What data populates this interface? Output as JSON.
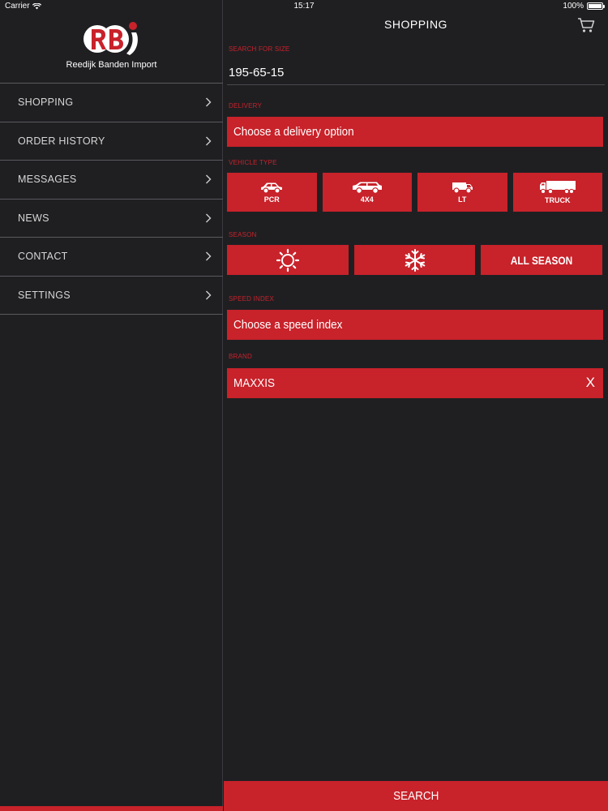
{
  "status_bar": {
    "carrier": "Carrier",
    "time": "15:17",
    "battery": "100%",
    "battery_level": 1.0
  },
  "sidebar": {
    "logo_text": "Reedijk Banden Import",
    "items": [
      {
        "label": "SHOPPING",
        "icon": "chevron-right-icon"
      },
      {
        "label": "ORDER HISTORY",
        "icon": "chevron-right-icon"
      },
      {
        "label": "MESSAGES",
        "icon": "chevron-right-icon"
      },
      {
        "label": "NEWS",
        "icon": "chevron-right-icon"
      },
      {
        "label": "CONTACT",
        "icon": "chevron-right-icon"
      },
      {
        "label": "SETTINGS",
        "icon": "chevron-right-icon"
      }
    ]
  },
  "main": {
    "title": "SHOPPING",
    "cart_icon": "cart-icon",
    "search_for_size": {
      "label": "SEARCH FOR SIZE",
      "value": "195-65-15"
    },
    "delivery": {
      "label": "DELIVERY",
      "value": "Choose a delivery option"
    },
    "vehicle_type": {
      "label": "VEHICLE TYPE",
      "options": [
        {
          "label": "PCR",
          "icon": "car-icon"
        },
        {
          "label": "4X4",
          "icon": "suv-icon"
        },
        {
          "label": "LT",
          "icon": "van-icon"
        },
        {
          "label": "TRUCK",
          "icon": "truck-icon"
        }
      ]
    },
    "season": {
      "label": "SEASON",
      "options": [
        {
          "label": "",
          "icon": "sun-icon"
        },
        {
          "label": "",
          "icon": "snowflake-icon"
        },
        {
          "label": "ALL SEASON",
          "icon": ""
        }
      ]
    },
    "speed_index": {
      "label": "SPEED INDEX",
      "value": "Choose a speed index"
    },
    "brand": {
      "label": "BRAND",
      "value": "MAXXIS",
      "clear": "X"
    },
    "search_button": "SEARCH"
  },
  "colors": {
    "accent": "#c8222a",
    "background": "#1f1f22",
    "divider": "#5a5a5e"
  }
}
